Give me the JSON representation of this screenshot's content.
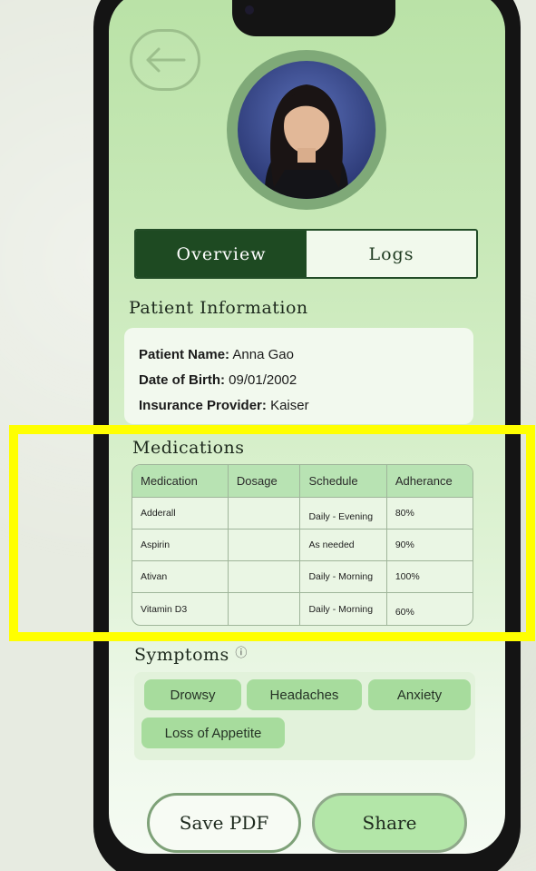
{
  "tabs": {
    "overview": "Overview",
    "logs": "Logs"
  },
  "patient_info": {
    "title": "Patient Information",
    "name_label": "Patient Name:",
    "name_value": "Anna Gao",
    "dob_label": "Date of Birth:",
    "dob_value": "09/01/2002",
    "insurance_label": "Insurance Provider:",
    "insurance_value": "Kaiser"
  },
  "medications": {
    "title": "Medications",
    "headers": [
      "Medication",
      "Dosage",
      "Schedule",
      "Adherance"
    ],
    "rows": [
      [
        "Adderall",
        "",
        "Daily - Evening",
        "80%"
      ],
      [
        "Aspirin",
        "",
        "As needed",
        "90%"
      ],
      [
        "Ativan",
        "",
        "Daily - Morning",
        "100%"
      ],
      [
        "Vitamin D3",
        "",
        "Daily - Morning",
        "60%"
      ]
    ]
  },
  "symptoms": {
    "title": "Symptoms",
    "info_icon": "info-icon",
    "chips": [
      "Drowsy",
      "Headaches",
      "Anxiety",
      "Loss of Appetite"
    ]
  },
  "actions": {
    "save_pdf": "Save PDF",
    "share": "Share"
  },
  "icons": {
    "back": "arrow-left-icon"
  },
  "colors": {
    "accent_dark": "#1e4a22",
    "chip": "#a7dc9d",
    "highlight": "#ffff00"
  }
}
